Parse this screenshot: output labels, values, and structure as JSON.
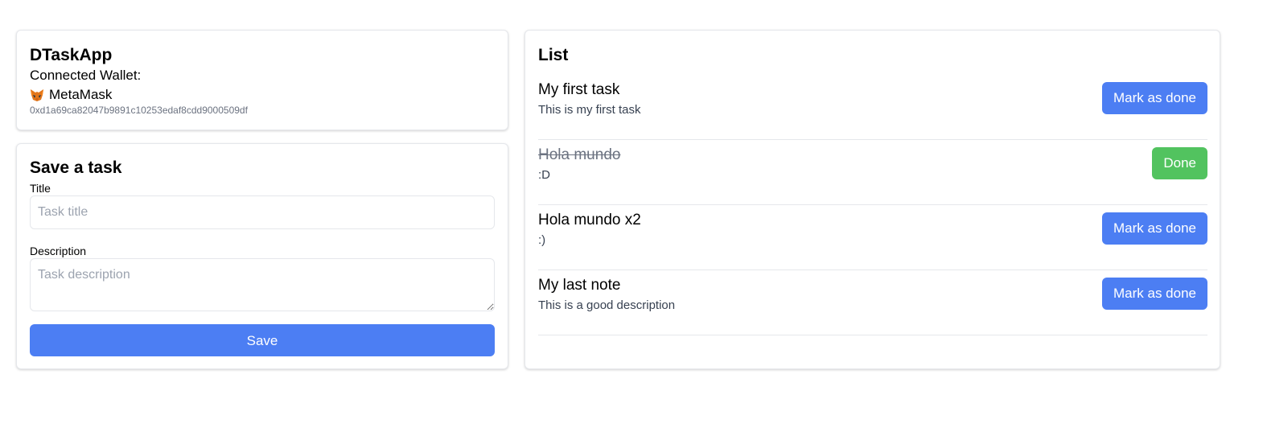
{
  "wallet": {
    "app_title": "DTaskApp",
    "connected_label": "Connected Wallet:",
    "provider_icon": "metamask-fox-icon",
    "provider_name": "MetaMask",
    "address": "0xd1a69ca82047b9891c10253edaf8cdd9000509df"
  },
  "form": {
    "heading": "Save a task",
    "title_label": "Title",
    "title_placeholder": "Task title",
    "title_value": "",
    "description_label": "Description",
    "description_placeholder": "Task description",
    "description_value": "",
    "save_label": "Save"
  },
  "list": {
    "heading": "List",
    "tasks": [
      {
        "title": "My first task",
        "description": "This is my first task",
        "done": false,
        "button_label": "Mark as done"
      },
      {
        "title": "Hola mundo",
        "description": ":D",
        "done": true,
        "button_label": "Done"
      },
      {
        "title": "Hola mundo x2",
        "description": ":)",
        "done": false,
        "button_label": "Mark as done"
      },
      {
        "title": "My last note",
        "description": "This is a good description",
        "done": false,
        "button_label": "Mark as done"
      }
    ]
  },
  "colors": {
    "primary": "#4c7ef3",
    "success": "#52c35f",
    "border": "#e5e7eb",
    "muted_text": "#6b7280"
  }
}
